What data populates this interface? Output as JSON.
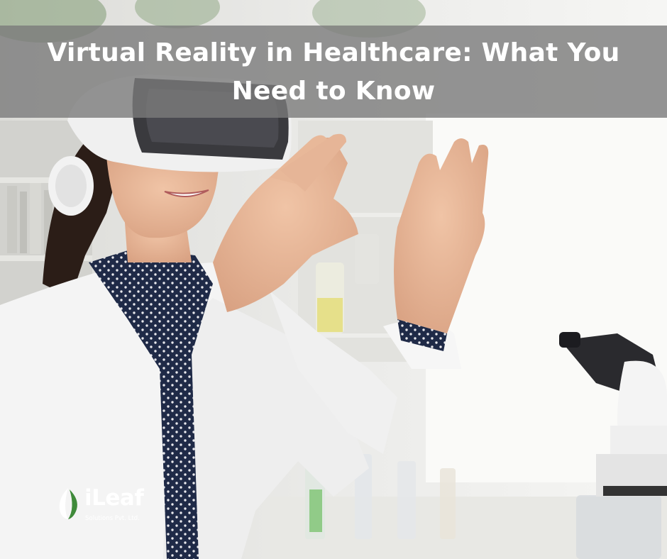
{
  "title": {
    "line1": "Virtual Reality in Healthcare: What You",
    "line2": "Need to Know"
  },
  "logo": {
    "name": "iLeaf",
    "subtitle": "Solutions Pvt. Ltd.",
    "icon": "leaf-icon"
  },
  "colors": {
    "title_band": "#7a7a7a",
    "title_text": "#ffffff",
    "lab_coat": "#f4f4f4",
    "blouse": "#1f2a47",
    "logo_green": "#3f8a3a"
  }
}
